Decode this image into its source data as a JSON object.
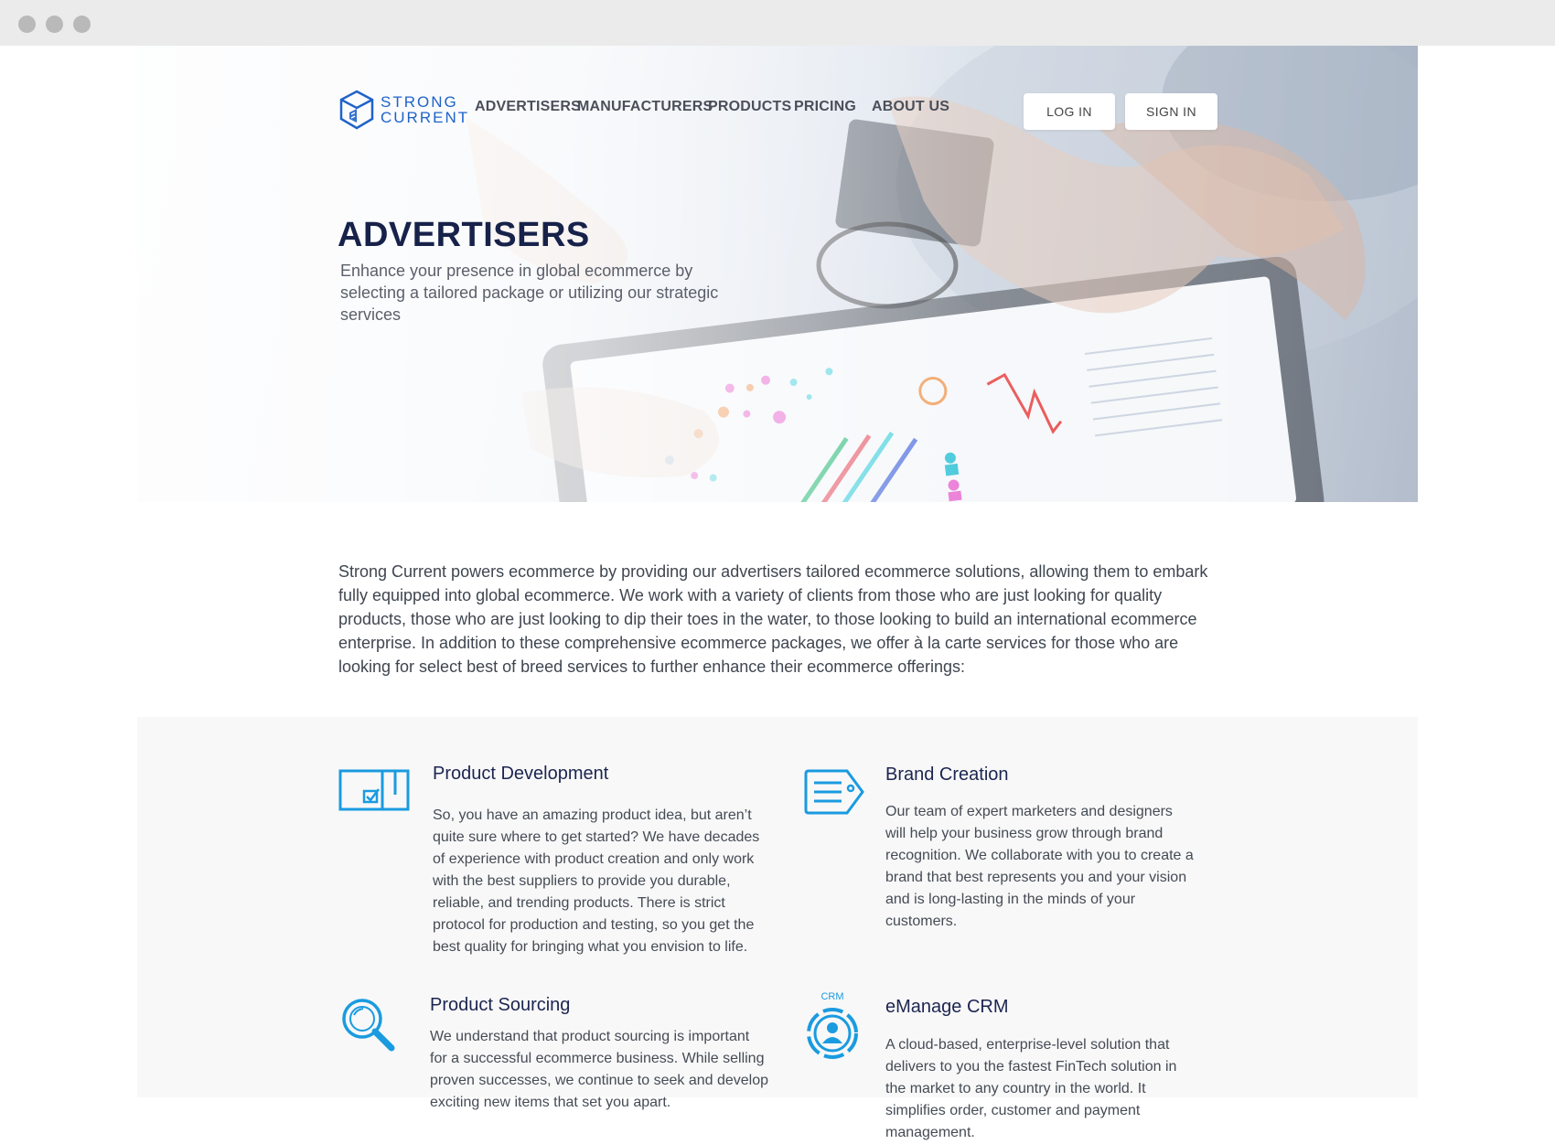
{
  "brand": {
    "line1": "STRONG",
    "line2": "CURRENT",
    "color": "#1f63c9"
  },
  "nav": {
    "items": [
      {
        "label": "ADVERTISERS"
      },
      {
        "label": "MANUFACTURERS"
      },
      {
        "label": "PRODUCTS"
      },
      {
        "label": "PRICING"
      },
      {
        "label": "ABOUT US"
      }
    ],
    "login_label": "LOG IN",
    "signin_label": "SIGN IN"
  },
  "hero": {
    "title": "ADVERTISERS",
    "subtitle": "Enhance your presence in global ecommerce by selecting a tailored package or utilizing our strategic services"
  },
  "intro": {
    "text": "Strong Current powers ecommerce by providing our advertisers tailored ecommerce solutions, allowing them to embark fully equipped into global ecommerce.  We work with a variety of clients from those who are just looking for quality products, those who are just looking to dip their toes in the water, to those looking to build an international ecommerce enterprise. In addition to these comprehensive ecommerce packages, we offer à la carte services for those who are looking for select best of breed services to further enhance their ecommerce offerings:"
  },
  "services": [
    {
      "title": "Product Development",
      "icon": "product-box-icon",
      "description": "So, you have an amazing product idea, but aren’t quite sure where to get started? We have decades of experience with product creation and only work with the best suppliers to provide you durable, reliable, and trending products. There is strict protocol for production and testing, so you get the best quality for bringing what you envision to life."
    },
    {
      "title": "Brand Creation",
      "icon": "brand-tag-icon",
      "description": "Our team of expert marketers and designers will help your business grow through brand recognition. We collaborate with you to create a brand that best represents you and your vision and is long-lasting in the minds of your customers."
    },
    {
      "title": "Product Sourcing",
      "icon": "magnifier-icon",
      "description": "We understand that product sourcing is important for a successful ecommerce business. While selling proven successes, we continue to seek and develop exciting new items that set you apart."
    },
    {
      "title": "eManage CRM",
      "icon": "crm-user-icon",
      "icon_label": "CRM",
      "description": "A cloud-based, enterprise-level solution that delivers to you the fastest FinTech solution in the market to any country in the world. It simplifies order, customer and payment management."
    }
  ],
  "colors": {
    "accent": "#1a9be0",
    "heading": "#17224a",
    "panel": "#f8f8f8"
  }
}
